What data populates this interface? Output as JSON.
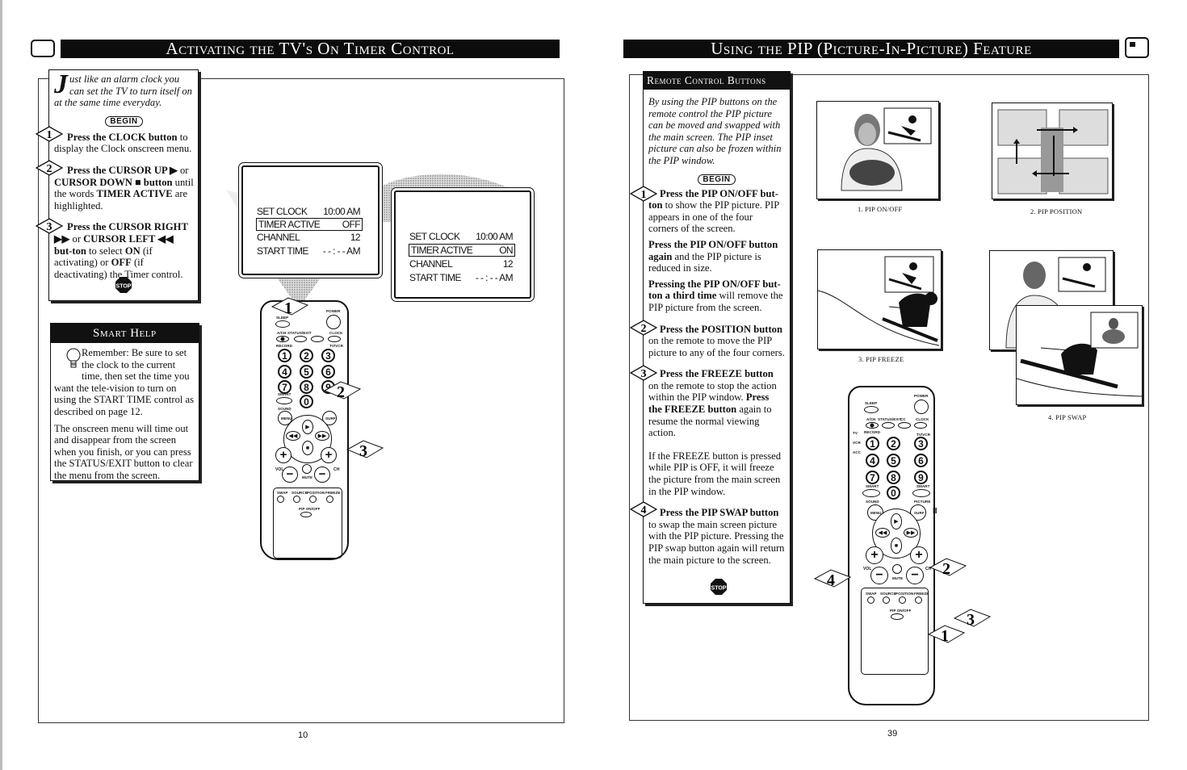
{
  "left_page": {
    "title": "Activating the TV's On Timer Control",
    "intro_dropcap": "J",
    "intro": "ust like an alarm clock you can set the TV to turn itself on at the same time everyday.",
    "begin_label": "BEGIN",
    "stop_label": "STOP",
    "steps": [
      {
        "number": "1",
        "bold": "Press the CLOCK button",
        "rest": " to display the Clock onscreen menu."
      },
      {
        "number": "2",
        "bold1": "Press the CURSOR UP ▶",
        "mid1": " or ",
        "bold2": "CURSOR DOWN ■ button",
        "mid2": " until the words ",
        "bold3": "TIMER ACTIVE",
        "rest": " are highlighted."
      },
      {
        "number": "3",
        "bold1": "Press the CURSOR RIGHT ▶▶",
        "mid1": " or ",
        "bold2": "CURSOR LEFT ◀◀ but-ton",
        "mid2": " to select ",
        "bold3": "ON",
        "mid3": " (if activating) or ",
        "bold4": "OFF",
        "rest": " (if deactivating) the Timer control."
      }
    ],
    "smart_help": {
      "title": "Smart Help",
      "para1": "Remember: Be sure to set the clock to the current time, then set the time you want the tele-vision to turn on using the START TIME control as described on page 12.",
      "para2": "The onscreen menu will time out and disappear from the screen when you finish, or you can press the STATUS/EXIT button to clear the menu from the screen."
    },
    "screen_before": {
      "rows": [
        {
          "label": "SET CLOCK",
          "value": "10:00  AM"
        },
        {
          "label": "TIMER ACTIVE",
          "value": "OFF",
          "highlighted": true
        },
        {
          "label": "CHANNEL",
          "value": "12"
        },
        {
          "label": "START TIME",
          "value": "- - : - - AM"
        }
      ]
    },
    "screen_after": {
      "rows": [
        {
          "label": "SET CLOCK",
          "value": "10:00  AM"
        },
        {
          "label": "TIMER ACTIVE",
          "value": "ON",
          "highlighted": true
        },
        {
          "label": "CHANNEL",
          "value": "12"
        },
        {
          "label": "START TIME",
          "value": "- - : - - AM"
        }
      ]
    },
    "remote_callouts": [
      "1",
      "2",
      "3"
    ],
    "page_number": "10"
  },
  "right_page": {
    "title": "Using the PIP (Picture-In-Picture) Feature",
    "section_title": "Remote Control Buttons",
    "intro": "By using the PIP buttons on the remote control the PIP picture can be moved and swapped with the main screen. The PIP inset picture can also be frozen within the PIP window.",
    "begin_label": "BEGIN",
    "stop_label": "STOP",
    "steps": [
      {
        "number": "1",
        "bold": "Press the PIP ON/OFF but-ton",
        "rest": " to show the PIP picture. PIP appears in one of the four corners of the screen."
      },
      {
        "number": "",
        "bold": "Press the PIP ON/OFF button again",
        "rest": " and the PIP picture is reduced in size."
      },
      {
        "number": "",
        "bold": "Pressing the PIP ON/OFF but-ton a third time",
        "rest": " will remove the PIP picture from the screen."
      },
      {
        "number": "2",
        "bold": "Press the POSITION button",
        "rest": " on the remote to move the PIP picture to any of the four corners."
      },
      {
        "number": "3",
        "bold": "Press the FREEZE button",
        "rest": " on the remote to stop the action within the PIP window. ",
        "bold2": "Press the FREEZE button",
        "rest2": " again to resume the normal viewing action."
      },
      {
        "number": "",
        "bold": "",
        "rest": "If the FREEZE button is pressed while PIP is OFF, it will freeze the picture from the main screen in the PIP window."
      },
      {
        "number": "4",
        "bold": "Press the PIP SWAP button",
        "rest": " to swap the main screen picture with the PIP picture. Pressing the PIP swap button again will return the main picture to the screen."
      }
    ],
    "figures": [
      {
        "caption": "1. PIP ON/OFF"
      },
      {
        "caption": "2. PIP POSITION"
      },
      {
        "caption": "3. PIP FREEZE"
      },
      {
        "caption": "4. PIP SWAP"
      }
    ],
    "remote_callouts": [
      "1",
      "2",
      "3",
      "4"
    ],
    "page_number": "39"
  },
  "remote": {
    "labels": {
      "power": "POWER",
      "sleep": "SLEEP",
      "ach": "A/CH",
      "status": "STATUS/EXIT",
      "cc": "CC",
      "clock": "CLOCK",
      "record": "RECORD",
      "tvvcr": "TV/VCR",
      "tv": "TV",
      "vcr": "VCR",
      "acc": "ACC",
      "smart_sound": "SMART",
      "sound": "SOUND",
      "smart_picture": "SMART",
      "picture": "PICTURE",
      "menu": "MENU",
      "surf": "SURF",
      "vol": "VOL",
      "ch": "CH",
      "mute": "MUTE",
      "swap": "SWAP",
      "source": "SOURCE",
      "position": "POSITION",
      "freeze": "FREEZE",
      "pip_onoff": "PIP ON/OFF"
    },
    "digits": [
      "1",
      "2",
      "3",
      "4",
      "5",
      "6",
      "7",
      "8",
      "9",
      "0"
    ]
  }
}
